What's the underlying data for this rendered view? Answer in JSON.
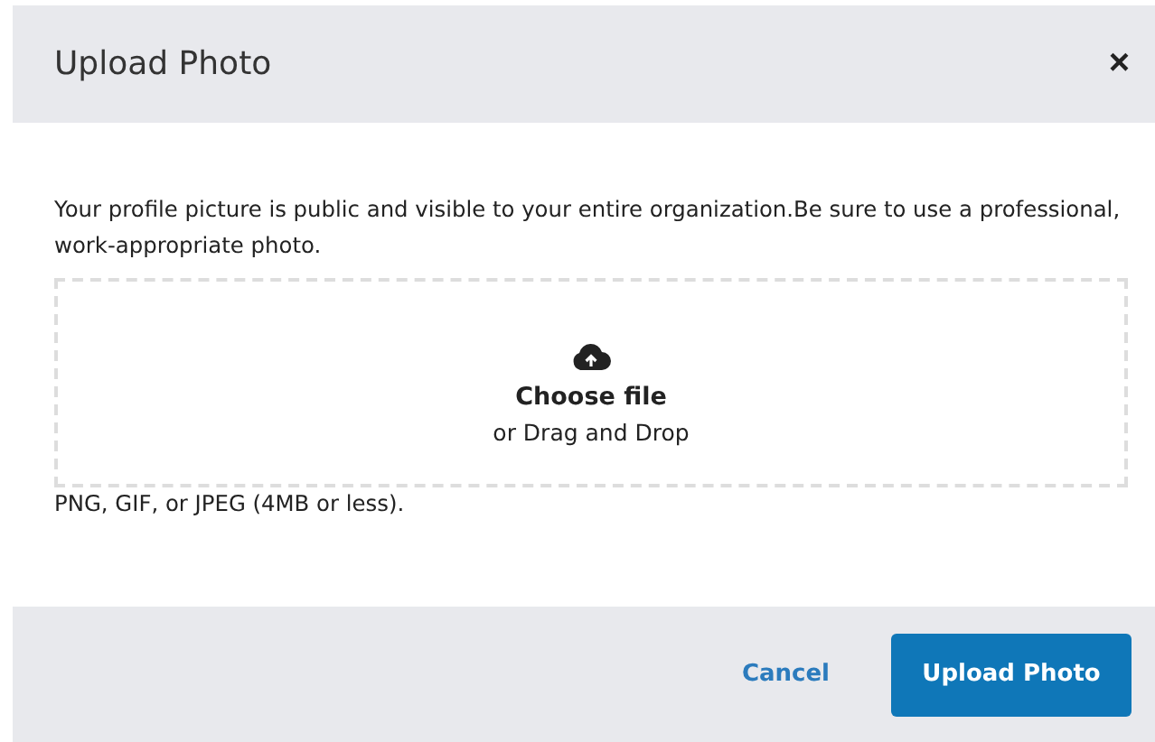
{
  "dialog": {
    "title": "Upload Photo",
    "close": "×"
  },
  "message": "Your profile picture is public and visible to your entire organization.Be sure to use a professional, work-appropriate photo.",
  "dropzone": {
    "action": "Choose file",
    "hint": "or Drag and Drop"
  },
  "note": "PNG, GIF, or JPEG (4MB or less).",
  "buttons": [
    {
      "label": "Cancel",
      "kind": "link"
    },
    {
      "label": "Upload Photo",
      "kind": "primary"
    }
  ]
}
